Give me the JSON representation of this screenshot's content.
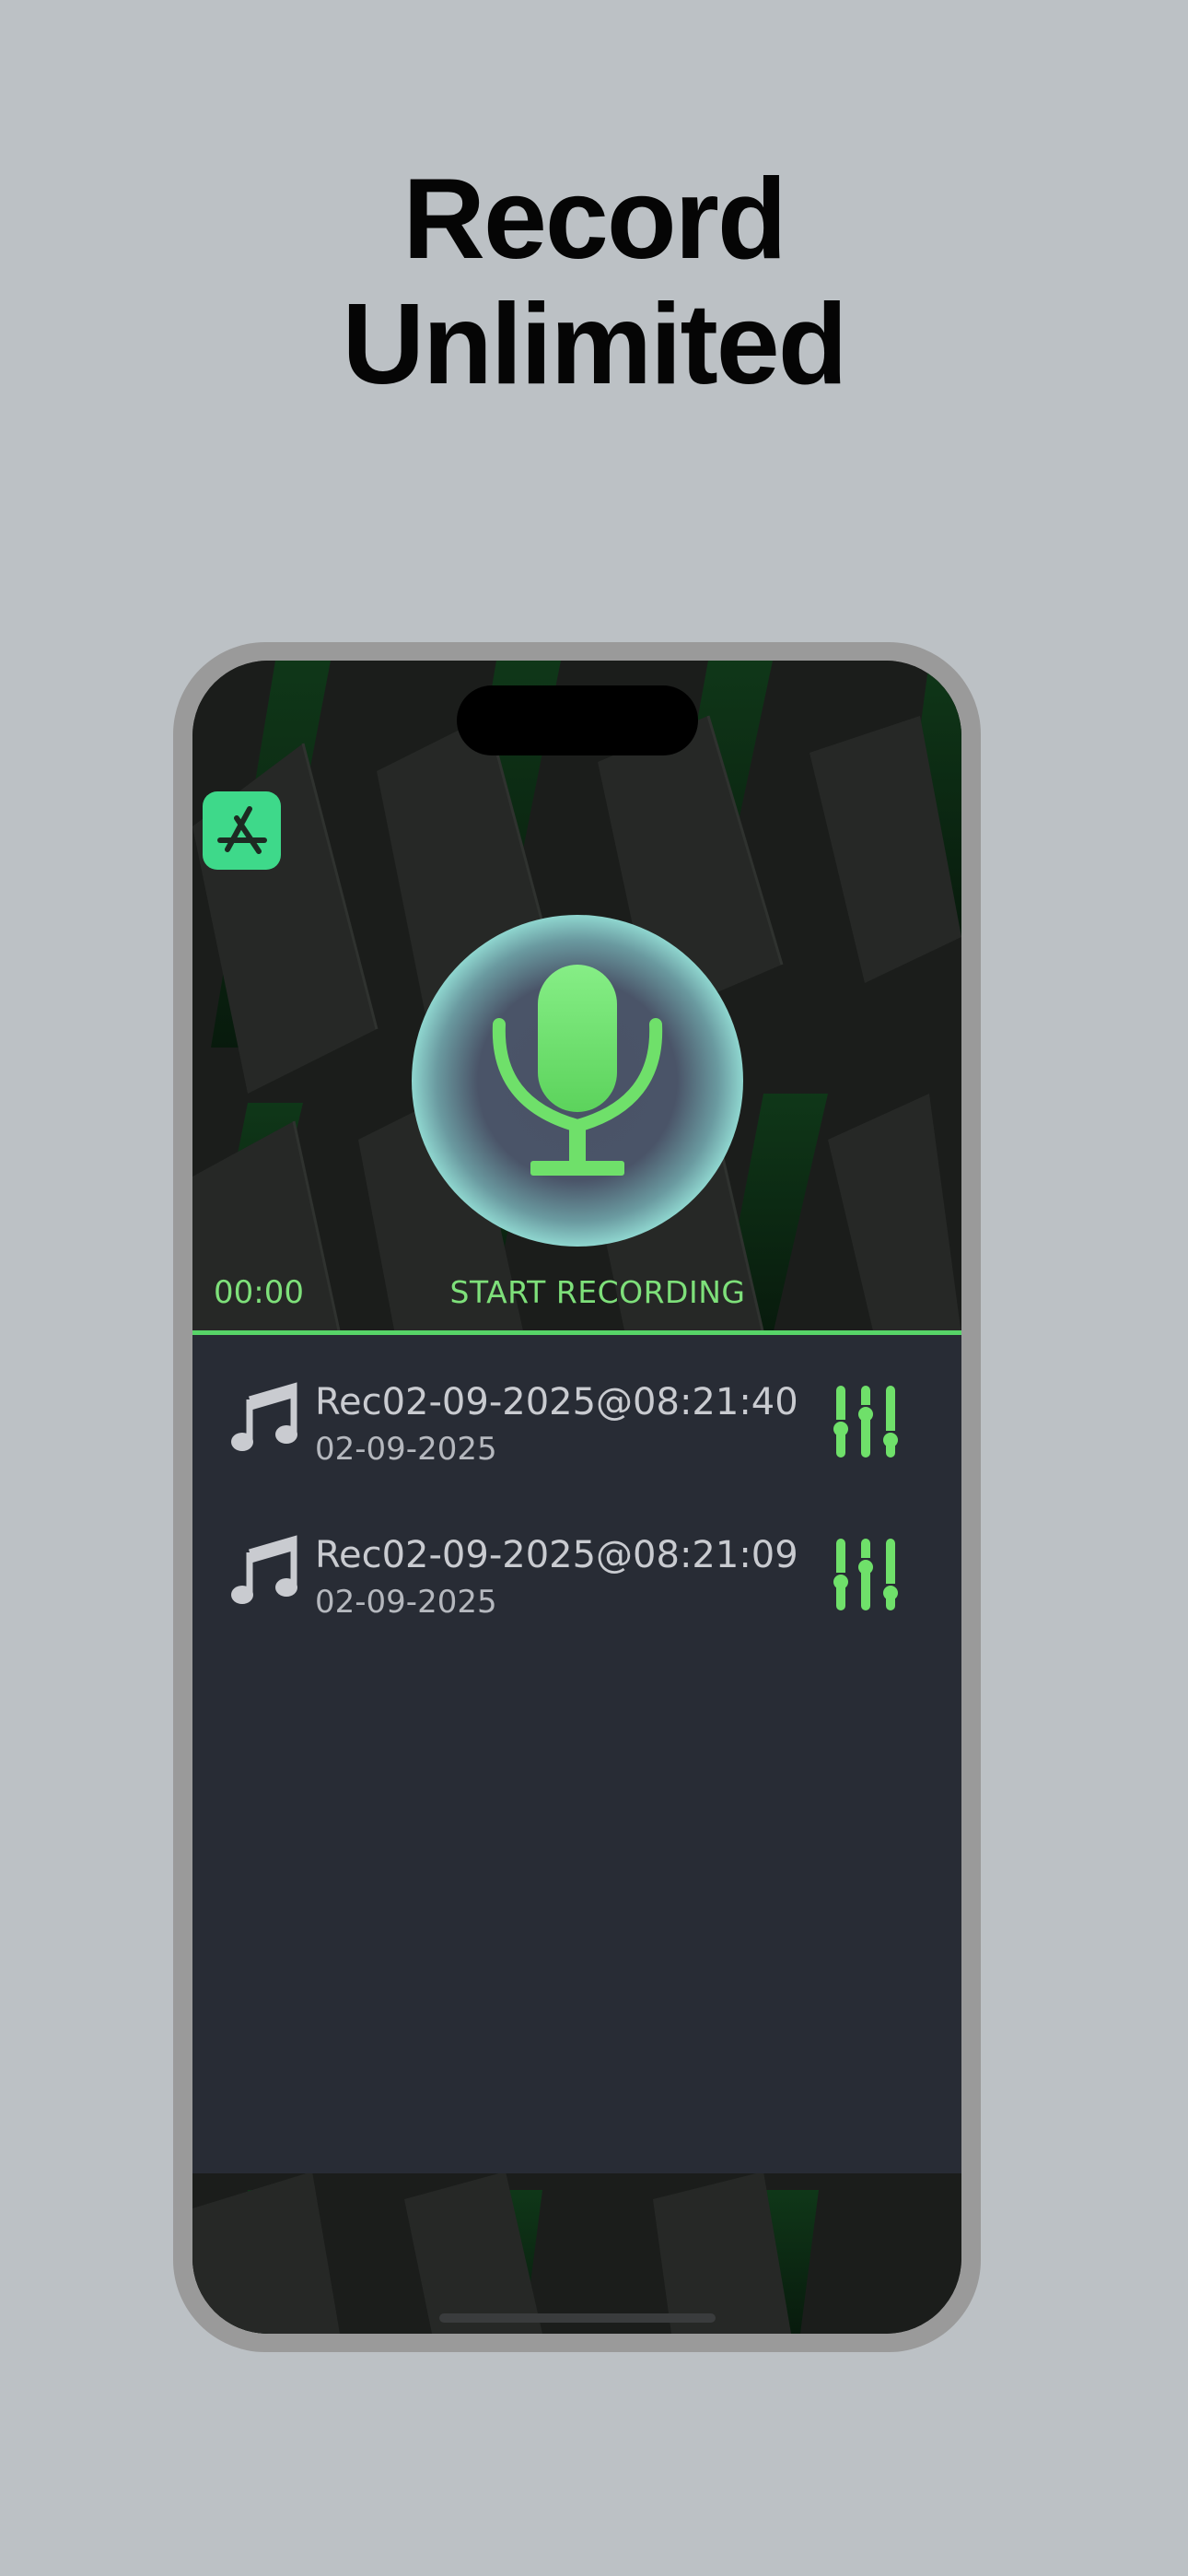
{
  "headline": {
    "line1": "Record",
    "line2": "Unlimited"
  },
  "app": {
    "icon": "app-store-icon",
    "accent_color": "#57d468"
  },
  "recorder": {
    "timer": "00:00",
    "start_label": "START RECORDING",
    "mic_icon": "microphone-icon"
  },
  "recordings": [
    {
      "name": "Rec02-09-2025@08:21:40",
      "date": "02-09-2025",
      "icon": "music-note-icon",
      "action_icon": "sliders-icon"
    },
    {
      "name": "Rec02-09-2025@08:21:09",
      "date": "02-09-2025",
      "icon": "music-note-icon",
      "action_icon": "sliders-icon"
    }
  ]
}
